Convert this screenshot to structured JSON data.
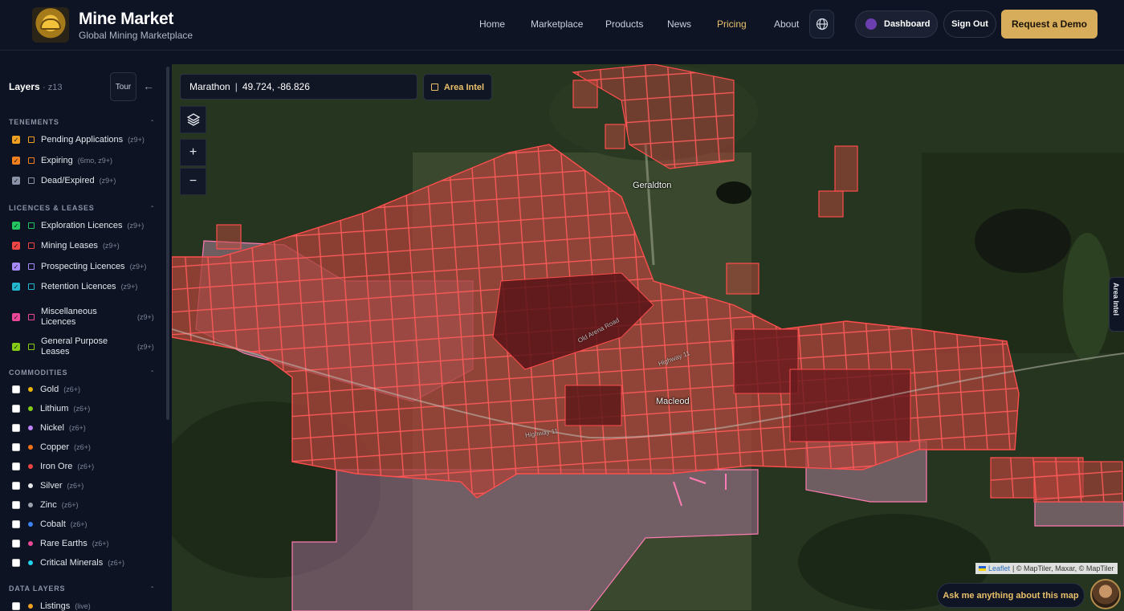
{
  "brand": {
    "title": "Mine Market",
    "subtitle": "Global Mining Marketplace"
  },
  "nav": [
    {
      "label": "Home",
      "active": false
    },
    {
      "label": "Marketplace",
      "active": false
    },
    {
      "label": "Products",
      "active": false
    },
    {
      "label": "News",
      "active": false
    },
    {
      "label": "Pricing",
      "active": true
    },
    {
      "label": "About",
      "active": false
    }
  ],
  "header": {
    "globe_icon": "globe-icon",
    "dashboard_label": "Dashboard",
    "signout_label": "Sign Out",
    "demo_label": "Request a Demo"
  },
  "sidebar": {
    "title": "Layers",
    "zoom": "· z13",
    "tour_label": "Tour",
    "collapse_icon": "←",
    "sections": {
      "tenements": {
        "title": "TENEMENTS",
        "items": [
          {
            "label": "Pending Applications",
            "zoom": "(z9+)",
            "checked": true,
            "color": "#f0a020"
          },
          {
            "label": "Expiring",
            "zoom": "(6mo, z9+)",
            "checked": true,
            "color": "#f07f20"
          },
          {
            "label": "Dead/Expired",
            "zoom": "(z9+)",
            "checked": true,
            "color": "#8a93a7"
          }
        ]
      },
      "licences": {
        "title": "LICENCES & LEASES",
        "items": [
          {
            "label": "Exploration Licences",
            "zoom": "(z9+)",
            "checked": true,
            "color": "#22c55e"
          },
          {
            "label": "Mining Leases",
            "zoom": "(z9+)",
            "checked": true,
            "color": "#ef4444"
          },
          {
            "label": "Prospecting Licences",
            "zoom": "(z9+)",
            "checked": true,
            "color": "#a78bfa"
          },
          {
            "label": "Retention Licences",
            "zoom": "(z9+)",
            "checked": true,
            "color": "#22b8cf"
          },
          {
            "label": "Miscellaneous Licences",
            "zoom": "(z9+)",
            "checked": true,
            "color": "#ec4899"
          },
          {
            "label": "General Purpose Leases",
            "zoom": "(z9+)",
            "checked": true,
            "color": "#84cc16"
          }
        ]
      },
      "commodities": {
        "title": "COMMODITIES",
        "items": [
          {
            "label": "Gold",
            "zoom": "(z6+)",
            "color": "#eab308"
          },
          {
            "label": "Lithium",
            "zoom": "(z6+)",
            "color": "#84cc16"
          },
          {
            "label": "Nickel",
            "zoom": "(z6+)",
            "color": "#c084fc"
          },
          {
            "label": "Copper",
            "zoom": "(z6+)",
            "color": "#f97316"
          },
          {
            "label": "Iron Ore",
            "zoom": "(z6+)",
            "color": "#ef4444"
          },
          {
            "label": "Silver",
            "zoom": "(z6+)",
            "color": "#e5e7eb"
          },
          {
            "label": "Zinc",
            "zoom": "(z6+)",
            "color": "#9ca3af"
          },
          {
            "label": "Cobalt",
            "zoom": "(z6+)",
            "color": "#3b82f6"
          },
          {
            "label": "Rare Earths",
            "zoom": "(z6+)",
            "color": "#ec4899"
          },
          {
            "label": "Critical Minerals",
            "zoom": "(z6+)",
            "color": "#22d3ee"
          }
        ]
      },
      "data_layers": {
        "title": "DATA LAYERS",
        "items": [
          {
            "label": "Listings",
            "zoom": "(live)",
            "color": "#f0a020"
          }
        ]
      }
    }
  },
  "map": {
    "location_name": "Marathon",
    "coords": "49.724, -86.826",
    "area_intel_label": "Area Intel",
    "side_tab_label": "Area Intel",
    "zoom_in": "+",
    "zoom_out": "−",
    "places": {
      "town1": "Geraldton",
      "town2": "Macleod"
    },
    "roads": {
      "r1": "Old Arena Road",
      "r2": "Highway 11",
      "r3": "Highway 11"
    },
    "attribution": {
      "leaflet": "Leaflet",
      "rest": "| © MapTiler, Maxar, © MapTiler"
    },
    "ask_label": "Ask me anything about this map"
  }
}
